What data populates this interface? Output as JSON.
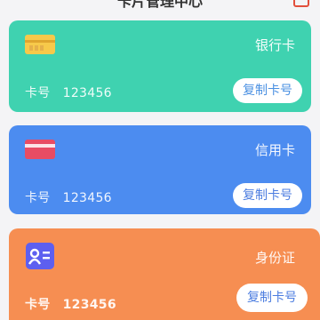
{
  "header": {
    "title": "卡片管理中心",
    "icon": "share-icon"
  },
  "cards": [
    {
      "type": "银行卡",
      "no_label": "卡号",
      "no_value": "123456",
      "copy_label": "复制卡号",
      "icon": "bank-card-icon",
      "color": "#3fd2b0"
    },
    {
      "type": "信用卡",
      "no_label": "卡号",
      "no_value": "123456",
      "copy_label": "复制卡号",
      "icon": "credit-card-icon",
      "color": "#4c8cf0"
    },
    {
      "type": "身份证",
      "no_label": "卡号",
      "no_value": "123456",
      "copy_label": "复制卡号",
      "icon": "id-card-icon",
      "color": "#f68e52"
    }
  ]
}
